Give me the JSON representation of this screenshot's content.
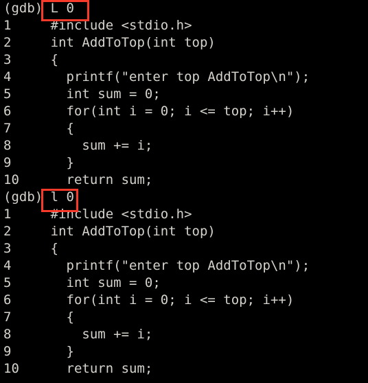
{
  "terminal": {
    "background_color": "#000000",
    "text_color": "#d6d3cd",
    "highlight_color": "#f73a2a",
    "prompt": "(gdb)"
  },
  "blocks": [
    {
      "prompt": "(gdb)",
      "command": "L 0",
      "highlighted": true,
      "listing": [
        {
          "number": "1",
          "code": "     #include <stdio.h>"
        },
        {
          "number": "2",
          "code": "     int AddToTop(int top)"
        },
        {
          "number": "3",
          "code": "     {"
        },
        {
          "number": "4",
          "code": "       printf(\"enter top AddToTop\\n\");"
        },
        {
          "number": "5",
          "code": "       int sum = 0;"
        },
        {
          "number": "6",
          "code": "       for(int i = 0; i <= top; i++)"
        },
        {
          "number": "7",
          "code": "       {"
        },
        {
          "number": "8",
          "code": "         sum += i;"
        },
        {
          "number": "9",
          "code": "       }"
        },
        {
          "number": "10",
          "code": "      return sum;"
        }
      ]
    },
    {
      "prompt": "(gdb)",
      "command": "l 0",
      "highlighted": true,
      "listing": [
        {
          "number": "1",
          "code": "     #include <stdio.h>"
        },
        {
          "number": "2",
          "code": "     int AddToTop(int top)"
        },
        {
          "number": "3",
          "code": "     {"
        },
        {
          "number": "4",
          "code": "       printf(\"enter top AddToTop\\n\");"
        },
        {
          "number": "5",
          "code": "       int sum = 0;"
        },
        {
          "number": "6",
          "code": "       for(int i = 0; i <= top; i++)"
        },
        {
          "number": "7",
          "code": "       {"
        },
        {
          "number": "8",
          "code": "         sum += i;"
        },
        {
          "number": "9",
          "code": "       }"
        },
        {
          "number": "10",
          "code": "      return sum;"
        }
      ]
    }
  ]
}
